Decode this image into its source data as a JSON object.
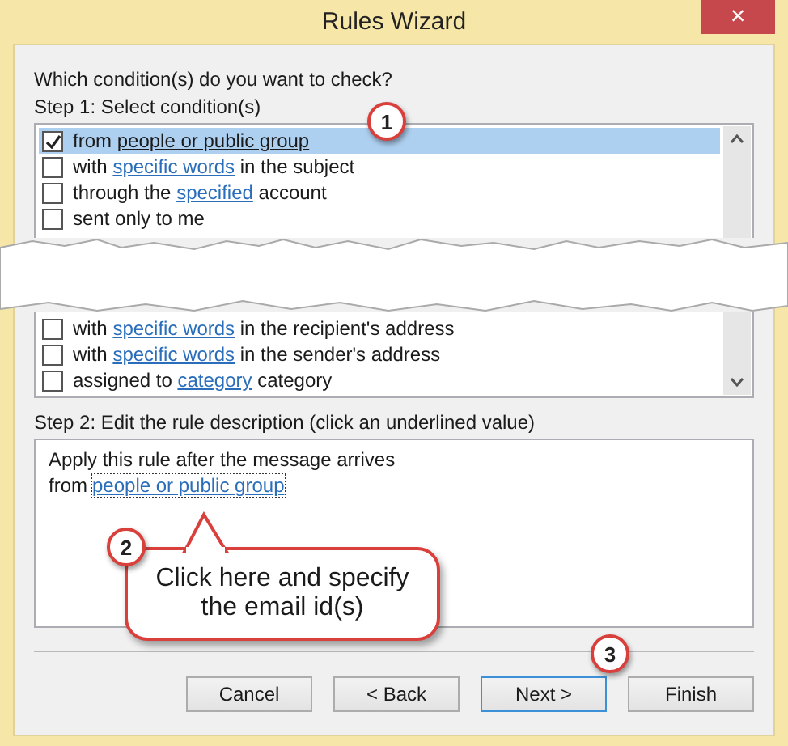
{
  "window": {
    "title": "Rules Wizard",
    "close": "×"
  },
  "question": "Which condition(s) do you want to check?",
  "step1": "Step 1: Select condition(s)",
  "conditions_top": [
    {
      "checked": true,
      "selected": true,
      "parts": [
        {
          "kind": "text",
          "text": "from "
        },
        {
          "kind": "link",
          "text": "people or public group"
        }
      ]
    },
    {
      "checked": false,
      "selected": false,
      "parts": [
        {
          "kind": "text",
          "text": "with "
        },
        {
          "kind": "link",
          "text": "specific words"
        },
        {
          "kind": "text",
          "text": " in the subject"
        }
      ]
    },
    {
      "checked": false,
      "selected": false,
      "parts": [
        {
          "kind": "text",
          "text": "through the "
        },
        {
          "kind": "link",
          "text": "specified"
        },
        {
          "kind": "text",
          "text": " account"
        }
      ]
    },
    {
      "checked": false,
      "selected": false,
      "parts": [
        {
          "kind": "text",
          "text": "sent only to me"
        }
      ]
    }
  ],
  "conditions_bottom": [
    {
      "checked": false,
      "selected": false,
      "parts": [
        {
          "kind": "text",
          "text": "with "
        },
        {
          "kind": "link",
          "text": "specific words"
        },
        {
          "kind": "text",
          "text": " in the recipient's address"
        }
      ]
    },
    {
      "checked": false,
      "selected": false,
      "parts": [
        {
          "kind": "text",
          "text": "with "
        },
        {
          "kind": "link",
          "text": "specific words"
        },
        {
          "kind": "text",
          "text": " in the sender's address"
        }
      ]
    },
    {
      "checked": false,
      "selected": false,
      "parts": [
        {
          "kind": "text",
          "text": "assigned to "
        },
        {
          "kind": "link",
          "text": "category"
        },
        {
          "kind": "text",
          "text": " category"
        }
      ]
    }
  ],
  "step2": "Step 2: Edit the rule description (click an underlined value)",
  "description": {
    "line1": "Apply this rule after the message arrives",
    "prefix": "from",
    "link": "people or public group"
  },
  "callouts": [
    {
      "number": "1"
    },
    {
      "number": "2",
      "text": "Click here and specify the email id(s)"
    },
    {
      "number": "3"
    }
  ],
  "buttons": [
    {
      "label": "Cancel",
      "default": false
    },
    {
      "label": "< Back",
      "default": false
    },
    {
      "label": "Next >",
      "default": true
    },
    {
      "label": "Finish",
      "default": false
    }
  ]
}
